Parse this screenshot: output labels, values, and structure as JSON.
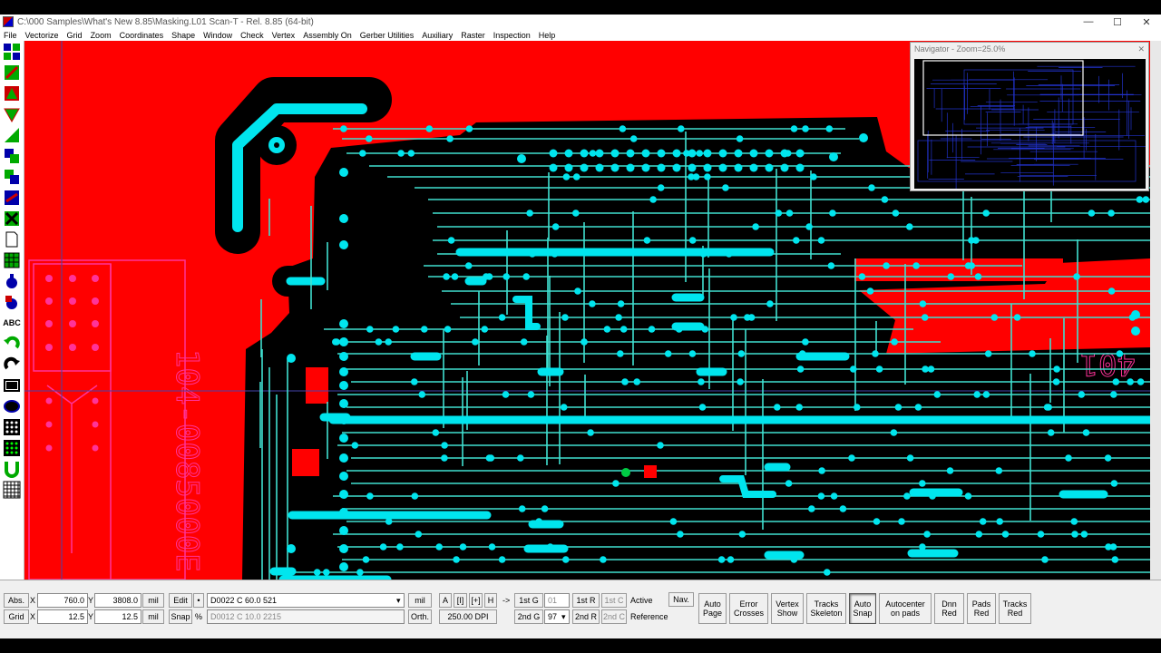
{
  "window": {
    "title": "C:\\000 Samples\\What's New 8.85\\Masking.L01  Scan-T - Rel. 8.85 (64-bit)",
    "minimize": "—",
    "maximize": "☐",
    "close": "✕"
  },
  "menu": [
    "File",
    "Vectorize",
    "Grid",
    "Zoom",
    "Coordinates",
    "Shape",
    "Window",
    "Check",
    "Vertex",
    "Assembly On",
    "Gerber Utilities",
    "Auxiliary",
    "Raster",
    "Inspection",
    "Help"
  ],
  "toolbar": {
    "icons": [
      "select-layers-icon",
      "layer-blue-icon",
      "layer-red-icon",
      "polygon-green-icon",
      "shape-green-icon",
      "layer-blue-2-icon",
      "layer-stack-icon",
      "track-red-icon",
      "track-cross-icon",
      "new-page-icon",
      "grid-green-icon",
      "drill-icon",
      "drill-red-icon",
      "text-tool-icon",
      "undo-icon",
      "redo-icon",
      "rectangle-icon",
      "ellipse-icon",
      "dot-grid-icon",
      "dot-grid-2-icon",
      "magnet-icon",
      "pixel-grid-icon"
    ],
    "text_tool_label": "ABC"
  },
  "canvas": {
    "colors": {
      "board": "#ff0000",
      "mask": "#000000",
      "pad": "#00e5ee",
      "trace": "#40e0d0",
      "outline": "#ff3399"
    },
    "labels": {
      "silk_right": "401",
      "silk_left_part": "104-0085000E"
    }
  },
  "navigator": {
    "title": "Navigator - Zoom=25.0%",
    "close": "✕"
  },
  "status": {
    "abs_label": "Abs.",
    "x_label": "X",
    "y_label": "Y",
    "abs_x": "760.0",
    "abs_y": "3808.0",
    "unit1": "mil",
    "grid_label": "Grid",
    "grid_x": "12.5",
    "grid_y": "12.5",
    "unit2": "mil",
    "edit_button": "Edit",
    "snap_button": "Snap",
    "percent_sign": "%",
    "dcode_active": "D0022  C       60.0                          521",
    "dcode_ref": "D0012  C       10.0                                   2215",
    "unit3": "mil",
    "orth": "Orth.",
    "mode_buttons": [
      "A",
      "[I]",
      "[+]",
      "H"
    ],
    "dpi": "250.00 DPI",
    "arrow": "->",
    "first_g": "1st G",
    "first_g_val": "01",
    "second_g": "2nd G",
    "second_g_val": "97",
    "first_r": "1st R",
    "first_c": "1st C",
    "second_r": "2nd R",
    "second_c": "2nd C",
    "active": "Active",
    "reference": "Reference",
    "nav_button": "Nav.",
    "big_buttons": [
      [
        "Auto",
        "Page"
      ],
      [
        "Error",
        "Crosses"
      ],
      [
        "Vertex",
        "Show"
      ],
      [
        "Tracks",
        "Skeleton"
      ],
      [
        "Auto",
        "Snap"
      ],
      [
        "Autocenter",
        "on pads"
      ],
      [
        "Dnn",
        "Red"
      ],
      [
        "Pads",
        "Red"
      ],
      [
        "Tracks",
        "Red"
      ]
    ]
  }
}
